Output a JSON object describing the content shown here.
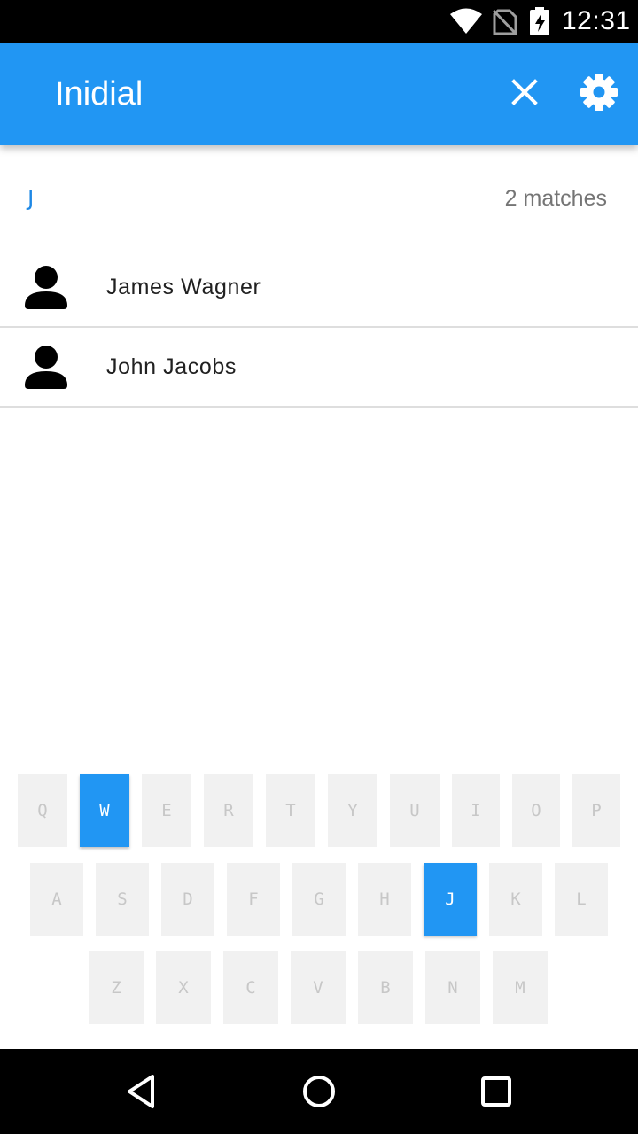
{
  "status_bar": {
    "time": "12:31",
    "icons": [
      "wifi-icon",
      "no-sim-icon",
      "battery-charging-icon"
    ]
  },
  "app_bar": {
    "title": "Inidial",
    "actions": [
      "close-icon",
      "settings-icon"
    ],
    "color": "#2196F3"
  },
  "query": {
    "letters": "J",
    "match_count": "2 matches"
  },
  "contacts": [
    {
      "name": "James Wagner",
      "icon": "person-icon"
    },
    {
      "name": "John Jacobs",
      "icon": "person-icon"
    }
  ],
  "keyboard": {
    "rows": [
      [
        "Q",
        "W",
        "E",
        "R",
        "T",
        "Y",
        "U",
        "I",
        "O",
        "P"
      ],
      [
        "A",
        "S",
        "D",
        "F",
        "G",
        "H",
        "J",
        "K",
        "L"
      ],
      [
        "Z",
        "X",
        "C",
        "V",
        "B",
        "N",
        "M"
      ]
    ],
    "active_keys": [
      "W",
      "J"
    ],
    "active_color": "#2196F3",
    "inactive_color": "#F1F1F1"
  },
  "nav_bar": {
    "icons": [
      "back-icon",
      "home-icon",
      "recents-icon"
    ]
  }
}
